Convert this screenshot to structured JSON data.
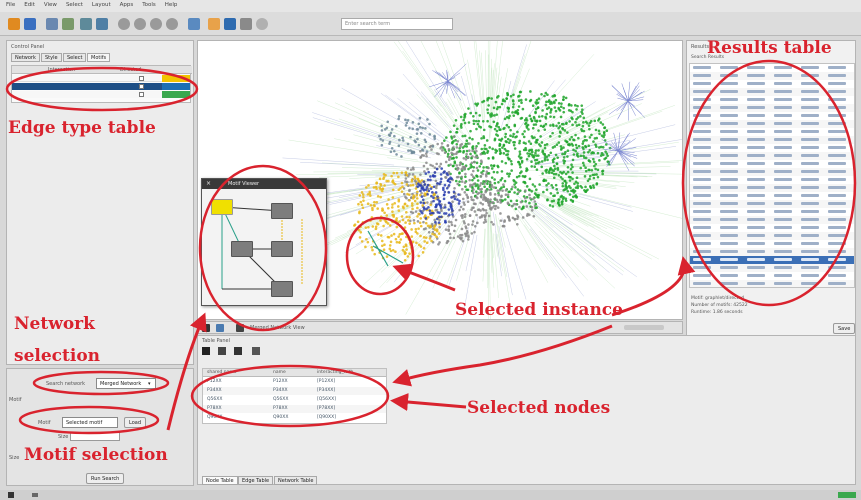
{
  "menubar": {
    "items": [
      "File",
      "Edit",
      "View",
      "Select",
      "Layout",
      "Apps",
      "Tools",
      "Help"
    ]
  },
  "toolbar": {
    "search_placeholder": "Enter search term",
    "icons": [
      "open-icon",
      "save-icon",
      "import-network-icon",
      "import-table-icon",
      "layout-icon",
      "share-icon",
      "zoom-in-icon",
      "zoom-out-icon",
      "zoom-fit-icon",
      "zoom-selected-icon",
      "refresh-icon",
      "export-icon",
      "first-neighbors-icon",
      "hide-icon",
      "help-icon"
    ]
  },
  "left_panel": {
    "title": "Control Panel",
    "tabs": [
      "Network",
      "Style",
      "Select",
      "Motifs"
    ],
    "edge_table": {
      "headers": [
        "Interaction",
        "Directed"
      ],
      "rows": [
        "",
        "",
        ""
      ],
      "row_colors": [
        "#f2c400",
        "#1b6fb3",
        "#3aa84e"
      ]
    }
  },
  "network_selection": {
    "label": "Search network",
    "value": "Merged Network"
  },
  "motif_selection": {
    "motif_label": "Motif",
    "motif_value": "Selected motif",
    "motif_button": "Load",
    "size_label": "Size",
    "run_button": "Run Search"
  },
  "motif_window": {
    "title": "Motif Viewer",
    "node_labels": [
      "",
      "",
      "",
      "",
      ""
    ]
  },
  "canvas": {
    "network_label": "Merged Network View"
  },
  "results": {
    "title": "Results",
    "subheader": "Search Results",
    "summary_lines": [
      "Motif: graphlet/directed",
      "Number of motifs: 42522",
      "Runtime: 1.86 seconds"
    ],
    "save_button": "Save"
  },
  "node_table": {
    "title": "Table Panel",
    "headers": [
      "shared name",
      "name",
      "interacting_with"
    ],
    "rows": [
      [
        "P12XX",
        "P12XX",
        "[P12XX]"
      ],
      [
        "P34XX",
        "P34XX",
        "[P34XX]"
      ],
      [
        "Q56XX",
        "Q56XX",
        "[Q56XX]"
      ],
      [
        "P78XX",
        "P78XX",
        "[P78XX]"
      ],
      [
        "Q90XX",
        "Q90XX",
        "[Q90XX]"
      ]
    ],
    "tabs": [
      "Node Table",
      "Edge Table",
      "Network Table"
    ]
  },
  "annotations": {
    "results_table": "Results table",
    "edge_type_table": "Edge type table",
    "network_selection_line1": "Network",
    "network_selection_line2": "selection",
    "selected_instance": "Selected instance",
    "selected_nodes": "Selected nodes",
    "motif_selection": "Motif selection"
  },
  "colors": {
    "annotation_red": "#d9232e",
    "node_green": "#1ea52a",
    "node_yellow": "#e8b81a",
    "node_blue": "#2c3fb0",
    "node_gray": "#8a8a8a",
    "selection_blue": "#3b6fb6"
  }
}
